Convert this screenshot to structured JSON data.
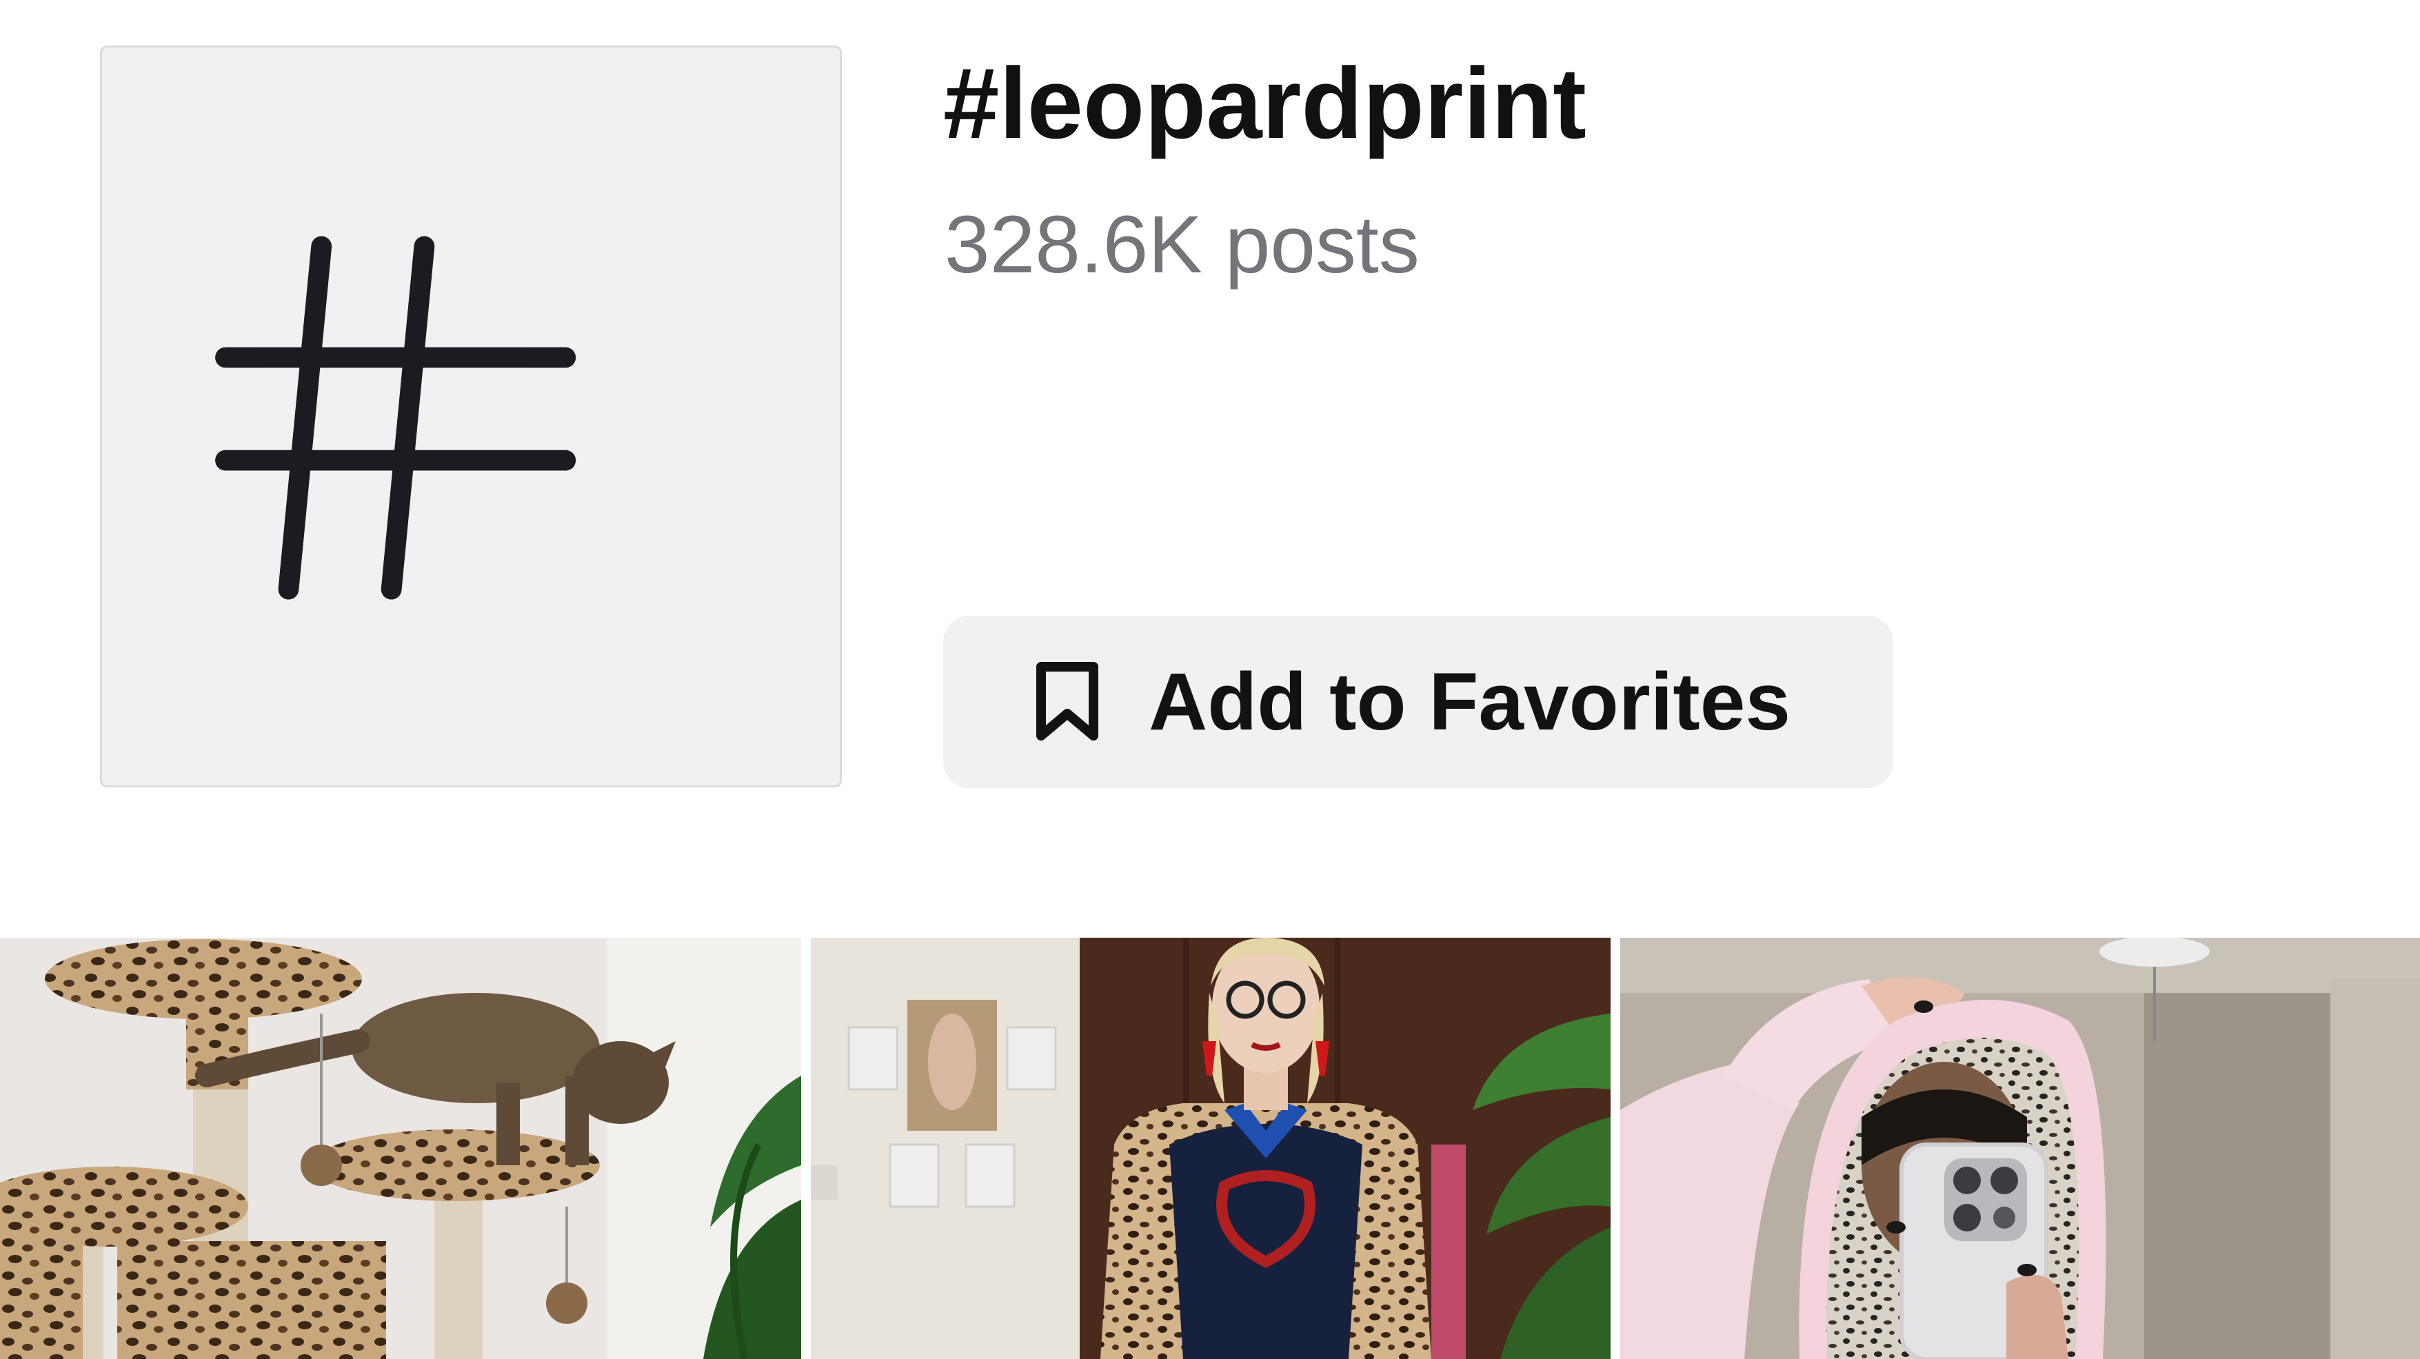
{
  "hashtag": {
    "title": "#leopardprint",
    "post_count": "328.6K posts",
    "icon": "hashtag-icon"
  },
  "actions": {
    "favorite_label": "Add to Favorites",
    "favorite_icon": "bookmark-icon"
  },
  "videos": [
    {
      "description": "tabby cat on a leopard print cat tree",
      "icon": "video-thumbnail"
    },
    {
      "description": "woman in leopard print outfit with blue scarf",
      "icon": "video-thumbnail"
    },
    {
      "description": "mirror selfie in leopard print lined pink hoodie",
      "icon": "video-thumbnail"
    }
  ],
  "colors": {
    "tile_bg": "#f1f1f2",
    "button_bg": "#f1f1f4",
    "title": "#111111",
    "muted": "#74747a"
  }
}
